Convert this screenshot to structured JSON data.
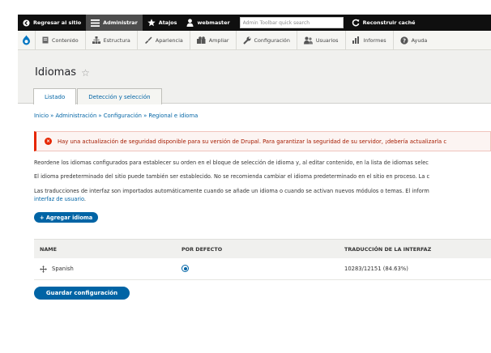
{
  "toolbar": {
    "back_label": "Regresar al sitio",
    "admin_label": "Administrar",
    "shortcuts_label": "Atajos",
    "user_label": "webmaster",
    "search_placeholder": "Admin Toolbar quick search",
    "rebuild_label": "Reconstruir caché"
  },
  "menu": {
    "items": [
      {
        "label": "Contenido",
        "icon": "document-icon"
      },
      {
        "label": "Estructura",
        "icon": "structure-icon"
      },
      {
        "label": "Apariencia",
        "icon": "paintbrush-icon"
      },
      {
        "label": "Ampliar",
        "icon": "puzzle-icon"
      },
      {
        "label": "Configuración",
        "icon": "wrench-icon"
      },
      {
        "label": "Usuarios",
        "icon": "users-icon"
      },
      {
        "label": "Informes",
        "icon": "bar-chart-icon"
      },
      {
        "label": "Ayuda",
        "icon": "help-icon"
      }
    ]
  },
  "page": {
    "title": "Idiomas",
    "tabs": [
      "Listado",
      "Detección y selección"
    ]
  },
  "breadcrumb": "Inicio » Administración » Configuración » Regional e idioma",
  "warning": "Hay una actualización de seguridad disponible para su versión de Drupal. Para garantizar la seguridad de su servidor, ¡debería actualizarla c",
  "paragraphs": {
    "p1": "Reordene los idiomas configurados para establecer su orden en el bloque de selección de idioma y, al editar contenido, en la lista de idiomas selec",
    "p2": "El idioma predeterminado del sitio puede también ser establecido. No se recomienda cambiar el idioma predeterminado en el sitio en proceso. La c",
    "p3_line1": "Las traducciones de interfaz son importados automáticamente cuando se añade un idioma o cuando se activan nuevos módulos o temas. El inform",
    "p3_link": "interfaz de usuario",
    "p3_end": "."
  },
  "add_button": "+ Agregar idioma",
  "table": {
    "headers": [
      "NAME",
      "POR DEFECTO",
      "TRADUCCIÓN DE LA INTERFAZ"
    ],
    "rows": [
      {
        "name": "Spanish",
        "default": true,
        "translation": "10283/12151 (84.63%)"
      }
    ]
  },
  "save_button": "Guardar configuración",
  "colors": {
    "toolbar_bg": "#0f0f0f",
    "accent": "#0064a5",
    "error": "#e62600"
  }
}
